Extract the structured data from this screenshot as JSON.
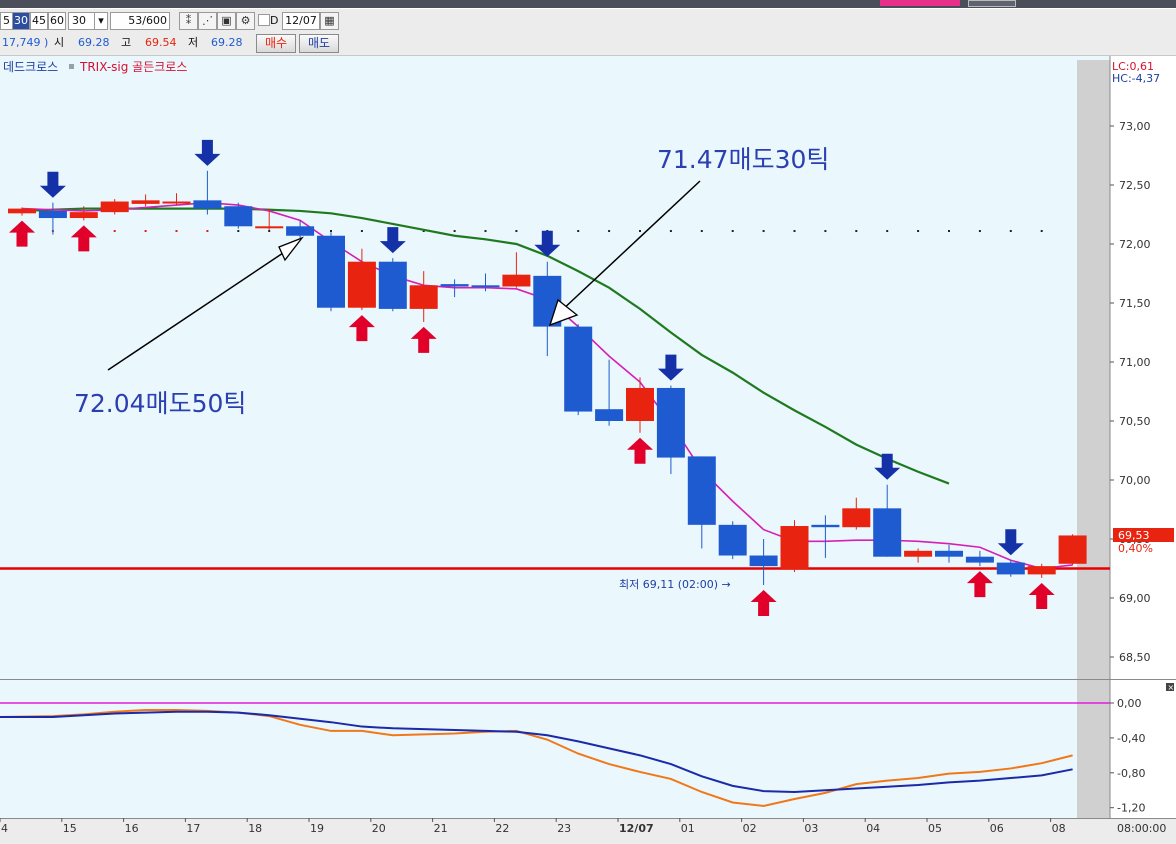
{
  "toolbar": {
    "periods": [
      "5",
      "30",
      "45",
      "60"
    ],
    "selected_period": "30",
    "period_input": "30",
    "count": "53/600",
    "checkbox_label": "D",
    "date": "12/07",
    "volume": "17,749 )",
    "open_label": "시",
    "open_value": "69.28",
    "high_label": "고",
    "high_value": "69.54",
    "low_label": "저",
    "low_value": "69.28",
    "buy_button": "매수",
    "sell_button": "매도"
  },
  "legend": {
    "dead_cross": "데드크로스",
    "trix_label": "TRIX-sig 골든크로스"
  },
  "right_labels": {
    "lc": "LC:0,61",
    "hc": "HC:-4,37"
  },
  "annotations": {
    "sell_50": "72.04매도50틱",
    "sell_30": "71.47매도30틱",
    "low_marker": "최저 69,11 (02:00) →"
  },
  "price_tag": {
    "value": "69,53",
    "change": "0,40%"
  },
  "colors": {
    "up": "#e8230f",
    "down": "#1f5bd0",
    "ma_long": "#1f7a1f",
    "ma_short": "#d61fb5",
    "support": "#e80000",
    "buy_arrow": "#e0002a",
    "sell_arrow": "#1431a8",
    "annotation": "#2a3fb0",
    "background": "#eaf7fd"
  },
  "chart_data": {
    "type": "candlestick",
    "ylim": [
      68.3,
      73.55
    ],
    "yticks": [
      "73,00",
      "72,50",
      "72,00",
      "71,50",
      "71,00",
      "70,50",
      "70,00",
      "69,50",
      "69,00",
      "68,50"
    ],
    "x_labels": [
      "4",
      "15",
      "16",
      "17",
      "18",
      "19",
      "20",
      "21",
      "22",
      "23",
      "12/07",
      "01",
      "02",
      "03",
      "04",
      "05",
      "06",
      "08"
    ],
    "x_axis_end": "08:00:00",
    "support_level": 69.25,
    "candles": [
      {
        "o": 72.26,
        "h": 72.31,
        "l": 72.24,
        "c": 72.3
      },
      {
        "o": 72.28,
        "h": 72.35,
        "l": 72.08,
        "c": 72.22
      },
      {
        "o": 72.22,
        "h": 72.32,
        "l": 72.2,
        "c": 72.27
      },
      {
        "o": 72.27,
        "h": 72.38,
        "l": 72.25,
        "c": 72.36
      },
      {
        "o": 72.34,
        "h": 72.42,
        "l": 72.32,
        "c": 72.37
      },
      {
        "o": 72.36,
        "h": 72.43,
        "l": 72.33,
        "c": 72.36
      },
      {
        "o": 72.37,
        "h": 72.62,
        "l": 72.25,
        "c": 72.3
      },
      {
        "o": 72.32,
        "h": 72.35,
        "l": 72.13,
        "c": 72.15
      },
      {
        "o": 72.15,
        "h": 72.3,
        "l": 72.12,
        "c": 72.15
      },
      {
        "o": 72.15,
        "h": 72.2,
        "l": 72.05,
        "c": 72.07
      },
      {
        "o": 72.07,
        "h": 72.1,
        "l": 71.43,
        "c": 71.46
      },
      {
        "o": 71.46,
        "h": 71.96,
        "l": 71.44,
        "c": 71.85
      },
      {
        "o": 71.85,
        "h": 71.88,
        "l": 71.43,
        "c": 71.45
      },
      {
        "o": 71.45,
        "h": 71.77,
        "l": 71.34,
        "c": 71.65
      },
      {
        "o": 71.66,
        "h": 71.7,
        "l": 71.55,
        "c": 71.64
      },
      {
        "o": 71.65,
        "h": 71.75,
        "l": 71.6,
        "c": 71.64
      },
      {
        "o": 71.64,
        "h": 71.93,
        "l": 71.63,
        "c": 71.74
      },
      {
        "o": 71.73,
        "h": 71.85,
        "l": 71.05,
        "c": 71.3
      },
      {
        "o": 71.3,
        "h": 71.32,
        "l": 70.55,
        "c": 70.58
      },
      {
        "o": 70.6,
        "h": 71.02,
        "l": 70.46,
        "c": 70.5
      },
      {
        "o": 70.5,
        "h": 70.87,
        "l": 70.4,
        "c": 70.78
      },
      {
        "o": 70.78,
        "h": 70.8,
        "l": 70.05,
        "c": 70.19
      },
      {
        "o": 70.2,
        "h": 70.2,
        "l": 69.42,
        "c": 69.62
      },
      {
        "o": 69.62,
        "h": 69.65,
        "l": 69.33,
        "c": 69.36
      },
      {
        "o": 69.36,
        "h": 69.5,
        "l": 69.11,
        "c": 69.27
      },
      {
        "o": 69.24,
        "h": 69.66,
        "l": 69.22,
        "c": 69.61
      },
      {
        "o": 69.62,
        "h": 69.7,
        "l": 69.34,
        "c": 69.6
      },
      {
        "o": 69.6,
        "h": 69.85,
        "l": 69.58,
        "c": 69.76
      },
      {
        "o": 69.76,
        "h": 69.96,
        "l": 69.35,
        "c": 69.35
      },
      {
        "o": 69.35,
        "h": 69.42,
        "l": 69.3,
        "c": 69.4
      },
      {
        "o": 69.4,
        "h": 69.45,
        "l": 69.3,
        "c": 69.35
      },
      {
        "o": 69.35,
        "h": 69.4,
        "l": 69.27,
        "c": 69.3
      },
      {
        "o": 69.3,
        "h": 69.32,
        "l": 69.18,
        "c": 69.2
      },
      {
        "o": 69.2,
        "h": 69.29,
        "l": 69.17,
        "c": 69.27
      },
      {
        "o": 69.29,
        "h": 69.54,
        "l": 69.28,
        "c": 69.53
      }
    ],
    "ma_long": [
      72.28,
      72.29,
      72.3,
      72.3,
      72.3,
      72.3,
      72.3,
      72.3,
      72.29,
      72.28,
      72.26,
      72.22,
      72.17,
      72.12,
      72.07,
      72.04,
      72.0,
      71.9,
      71.77,
      71.63,
      71.45,
      71.25,
      71.06,
      70.91,
      70.74,
      70.59,
      70.45,
      70.3,
      70.18,
      70.07,
      69.97
    ],
    "ma_long_start": 0,
    "ma_short": [
      72.3,
      72.29,
      72.28,
      72.29,
      72.31,
      72.33,
      72.35,
      72.33,
      72.28,
      72.2,
      72.02,
      71.85,
      71.73,
      71.65,
      71.63,
      71.63,
      71.62,
      71.53,
      71.3,
      71.05,
      70.83,
      70.48,
      70.08,
      69.82,
      69.58,
      69.48,
      69.48,
      69.49,
      69.49,
      69.48,
      69.46,
      69.43,
      69.32,
      69.25,
      69.28
    ],
    "cross_dots_y": 72.11,
    "sell_signals": [
      1,
      6,
      12,
      17,
      21,
      28,
      32
    ],
    "buy_signals": [
      0,
      2,
      11,
      13,
      20,
      24,
      31,
      33
    ],
    "trix": {
      "ylim": [
        -1.29,
        0.12
      ],
      "yticks": [
        "0,00",
        "-0,40",
        "-0,80",
        "-1,20"
      ],
      "zero_line": 0.0,
      "trix_line": [
        -0.16,
        -0.15,
        -0.13,
        -0.1,
        -0.08,
        -0.08,
        -0.09,
        -0.11,
        -0.15,
        -0.25,
        -0.32,
        -0.32,
        -0.37,
        -0.36,
        -0.35,
        -0.33,
        -0.32,
        -0.42,
        -0.58,
        -0.7,
        -0.79,
        -0.87,
        -1.02,
        -1.14,
        -1.18,
        -1.1,
        -1.03,
        -0.93,
        -0.89,
        -0.86,
        -0.81,
        -0.79,
        -0.75,
        -0.69,
        -0.6
      ],
      "signal_line": [
        -0.16,
        -0.16,
        -0.14,
        -0.12,
        -0.11,
        -0.1,
        -0.1,
        -0.11,
        -0.14,
        -0.18,
        -0.22,
        -0.27,
        -0.29,
        -0.3,
        -0.31,
        -0.32,
        -0.33,
        -0.37,
        -0.44,
        -0.52,
        -0.6,
        -0.7,
        -0.84,
        -0.95,
        -1.01,
        -1.02,
        -1.0,
        -0.98,
        -0.96,
        -0.94,
        -0.91,
        -0.89,
        -0.86,
        -0.83,
        -0.76
      ]
    }
  }
}
